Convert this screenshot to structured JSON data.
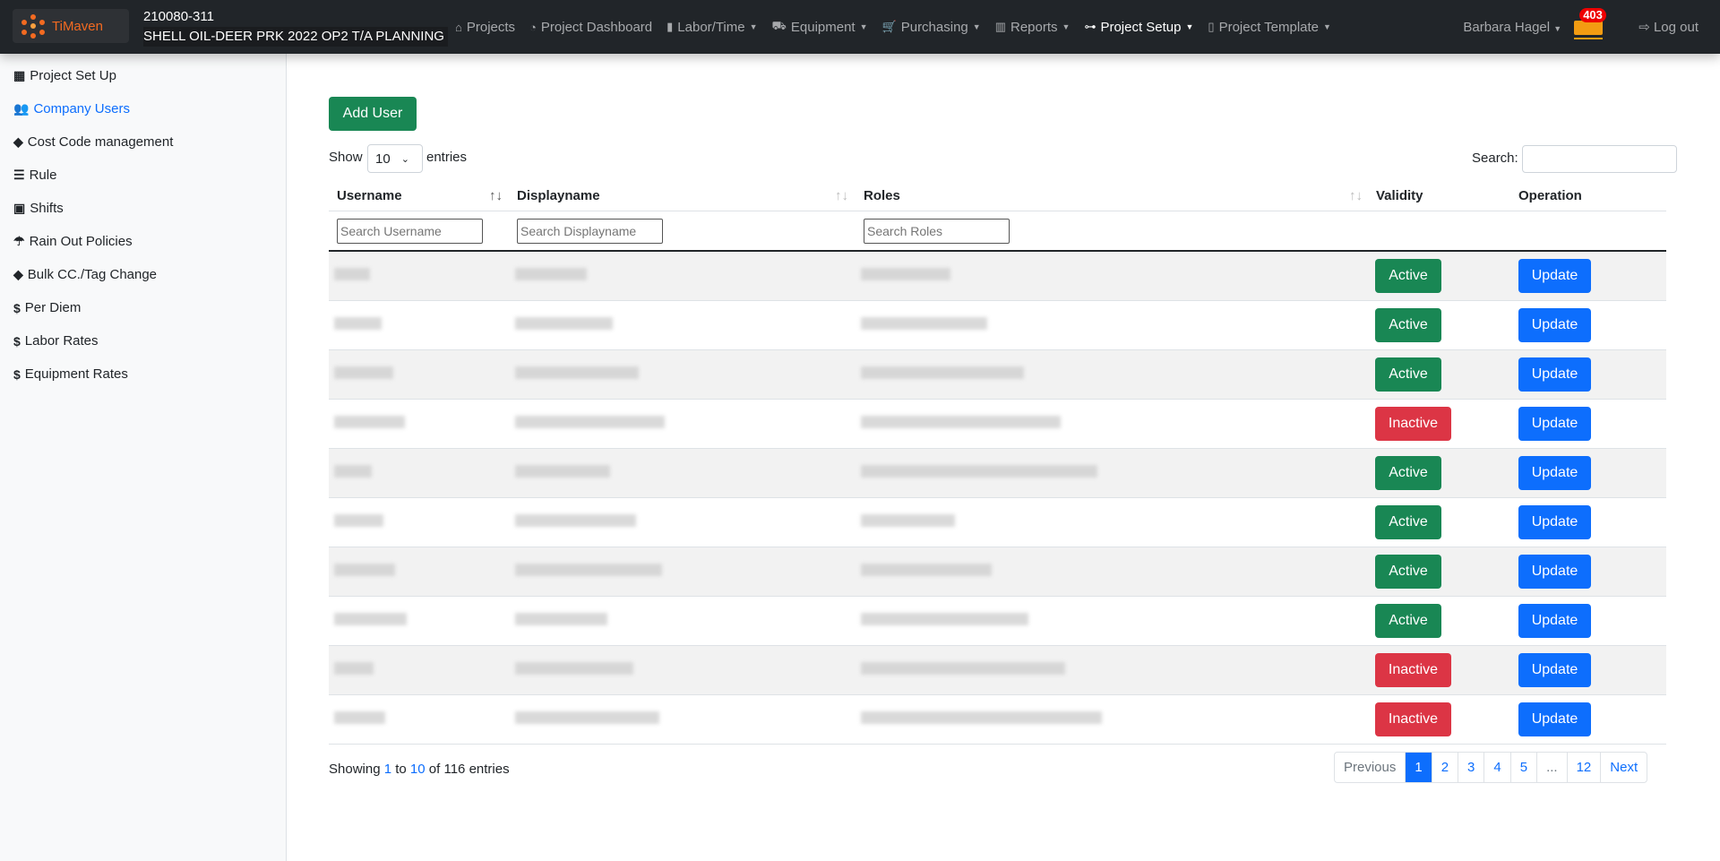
{
  "header": {
    "logo_text": "TiMaven",
    "project_code": "210080-311",
    "project_name": "SHELL OIL-DEER PRK 2022 OP2 T/A PLANNING",
    "menu": [
      {
        "label": "Projects",
        "icon": "home-icon"
      },
      {
        "label": "Project Dashboard",
        "icon": "dashboard-icon"
      },
      {
        "label": "Labor/Time",
        "icon": "id-badge-icon",
        "dropdown": true
      },
      {
        "label": "Equipment",
        "icon": "truck-icon",
        "dropdown": true
      },
      {
        "label": "Purchasing",
        "icon": "cart-icon",
        "dropdown": true
      },
      {
        "label": "Reports",
        "icon": "chart-icon",
        "dropdown": true
      },
      {
        "label": "Project Setup",
        "icon": "sitemap-icon",
        "dropdown": true,
        "active": true
      },
      {
        "label": "Project Template",
        "icon": "file-icon",
        "dropdown": true
      }
    ],
    "user": "Barbara Hagel",
    "inbox_count": "403",
    "logout": "Log out"
  },
  "sidebar": {
    "items": [
      {
        "label": "Project Set Up",
        "icon": "building-icon"
      },
      {
        "label": "Company Users",
        "icon": "users-icon",
        "active": true
      },
      {
        "label": "Cost Code management",
        "icon": "tags-icon"
      },
      {
        "label": "Rule",
        "icon": "sliders-icon"
      },
      {
        "label": "Shifts",
        "icon": "calendar-icon"
      },
      {
        "label": "Rain Out Policies",
        "icon": "cloud-rain-icon"
      },
      {
        "label": "Bulk CC./Tag Change",
        "icon": "tags-icon"
      },
      {
        "label": "Per Diem",
        "icon": "dollar-icon"
      },
      {
        "label": "Labor Rates",
        "icon": "dollar-icon"
      },
      {
        "label": "Equipment Rates",
        "icon": "dollar-icon"
      }
    ]
  },
  "main": {
    "add_user": "Add User",
    "show": "Show",
    "entries": "entries",
    "page_size": "10",
    "search_label": "Search:",
    "search_value": "",
    "columns": [
      "Username",
      "Displayname",
      "Roles",
      "Validity",
      "Operation"
    ],
    "filters": {
      "username": "Search Username",
      "displayname": "Search Displayname",
      "roles": "Search Roles"
    },
    "rows": [
      {
        "validity": "Active",
        "op": "Update"
      },
      {
        "validity": "Active",
        "op": "Update"
      },
      {
        "validity": "Active",
        "op": "Update"
      },
      {
        "validity": "Inactive",
        "op": "Update"
      },
      {
        "validity": "Active",
        "op": "Update"
      },
      {
        "validity": "Active",
        "op": "Update"
      },
      {
        "validity": "Active",
        "op": "Update"
      },
      {
        "validity": "Active",
        "op": "Update"
      },
      {
        "validity": "Inactive",
        "op": "Update"
      },
      {
        "validity": "Inactive",
        "op": "Update"
      }
    ],
    "info": {
      "prefix": "Showing",
      "from": "1",
      "to_word": "to",
      "to": "10",
      "of_word": "of",
      "total": "116",
      "suffix": "entries"
    },
    "pagination": [
      "Previous",
      "1",
      "2",
      "3",
      "4",
      "5",
      "...",
      "12",
      "Next"
    ],
    "current_page": "1"
  },
  "colors": {
    "active": "#198754",
    "inactive": "#dc3545",
    "update": "#0d6efd",
    "navbar": "#212529"
  }
}
